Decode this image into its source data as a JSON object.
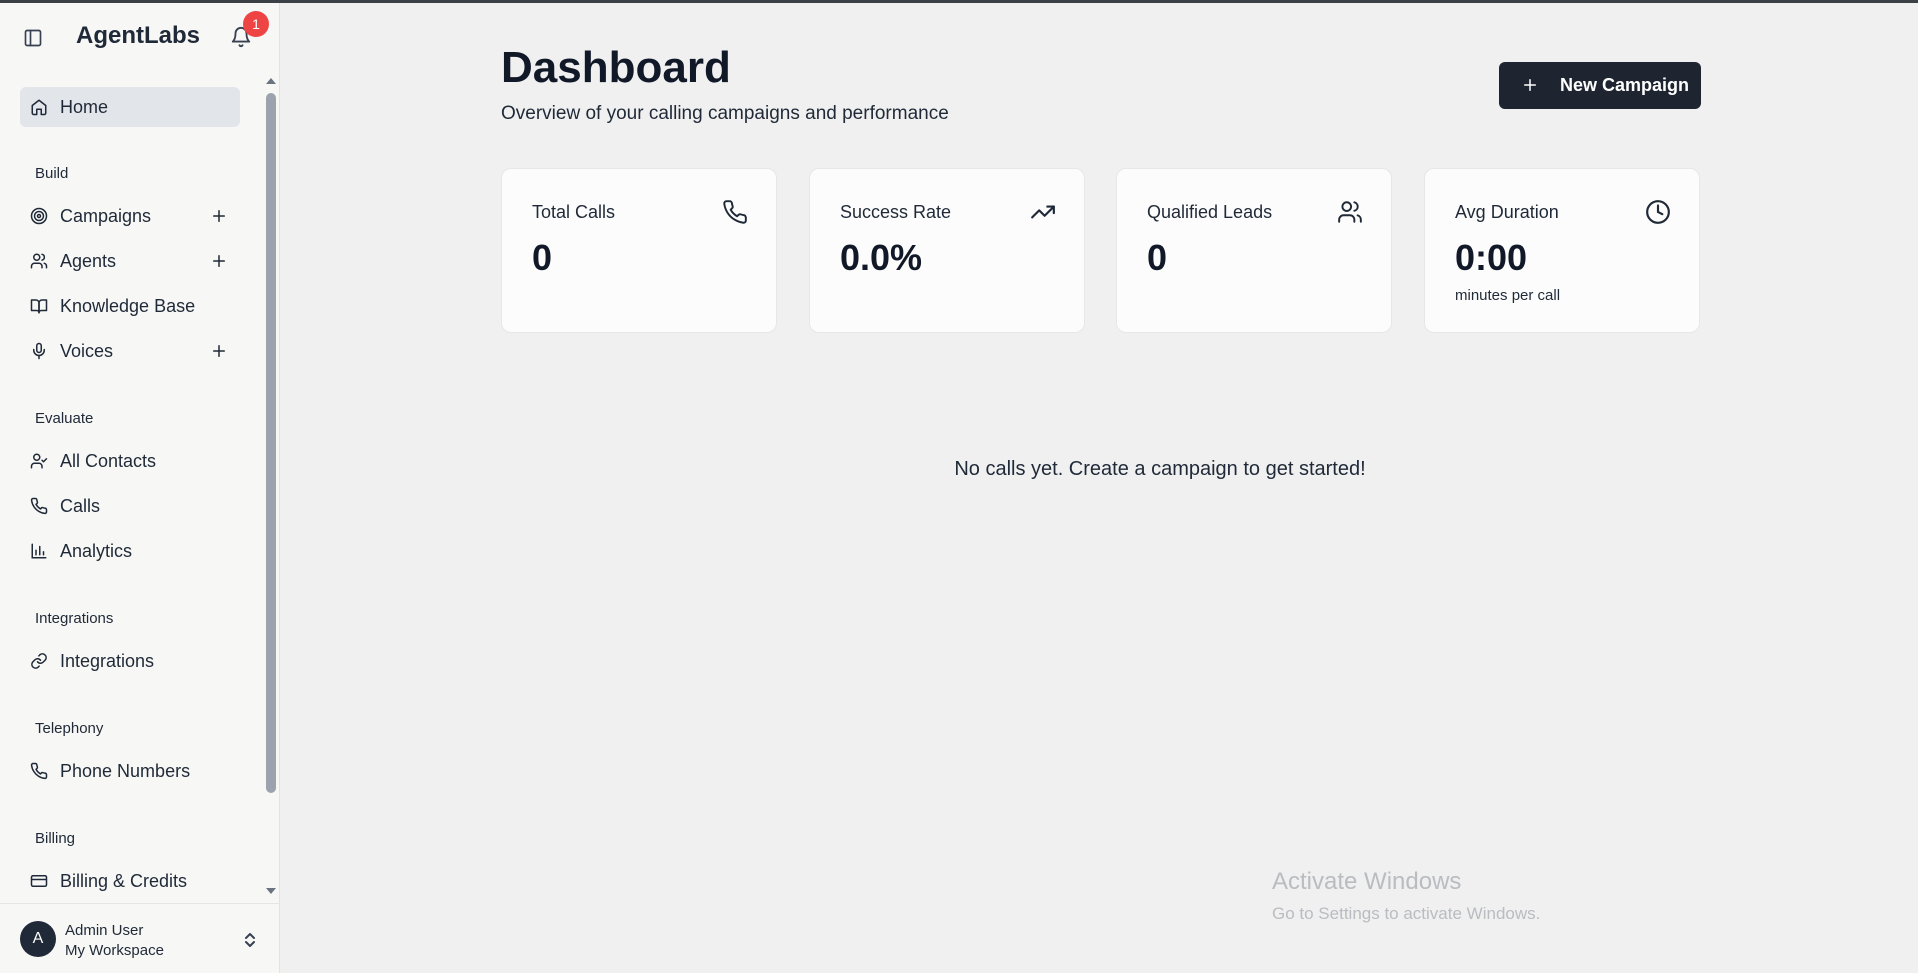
{
  "app": {
    "brand": "AgentLabs",
    "notification_count": "1"
  },
  "sidebar": {
    "home": "Home",
    "sections": {
      "build": "Build",
      "evaluate": "Evaluate",
      "integrations": "Integrations",
      "telephony": "Telephony",
      "billing": "Billing"
    },
    "items": {
      "campaigns": "Campaigns",
      "agents": "Agents",
      "knowledge_base": "Knowledge Base",
      "voices": "Voices",
      "all_contacts": "All Contacts",
      "calls": "Calls",
      "analytics": "Analytics",
      "integrations": "Integrations",
      "phone_numbers": "Phone Numbers",
      "billing_credits": "Billing & Credits"
    },
    "user": {
      "avatar_initial": "A",
      "name": "Admin User",
      "workspace": "My Workspace"
    }
  },
  "main": {
    "title": "Dashboard",
    "subtitle": "Overview of your calling campaigns and performance",
    "new_campaign_label": "New Campaign",
    "cards": [
      {
        "label": "Total Calls",
        "value": "0",
        "icon": "phone-icon"
      },
      {
        "label": "Success Rate",
        "value": "0.0%",
        "icon": "trending-up-icon"
      },
      {
        "label": "Qualified Leads",
        "value": "0",
        "icon": "users-icon"
      },
      {
        "label": "Avg Duration",
        "value": "0:00",
        "note": "minutes per call",
        "icon": "clock-icon"
      }
    ],
    "empty_message": "No calls yet. Create a campaign to get started!"
  },
  "watermark": {
    "line1": "Activate Windows",
    "line2": "Go to Settings to activate Windows."
  },
  "colors": {
    "primary_button": "#1f2530",
    "badge": "#ef4444",
    "active_nav": "#e2e5ea",
    "background": "#f0f0f0"
  }
}
